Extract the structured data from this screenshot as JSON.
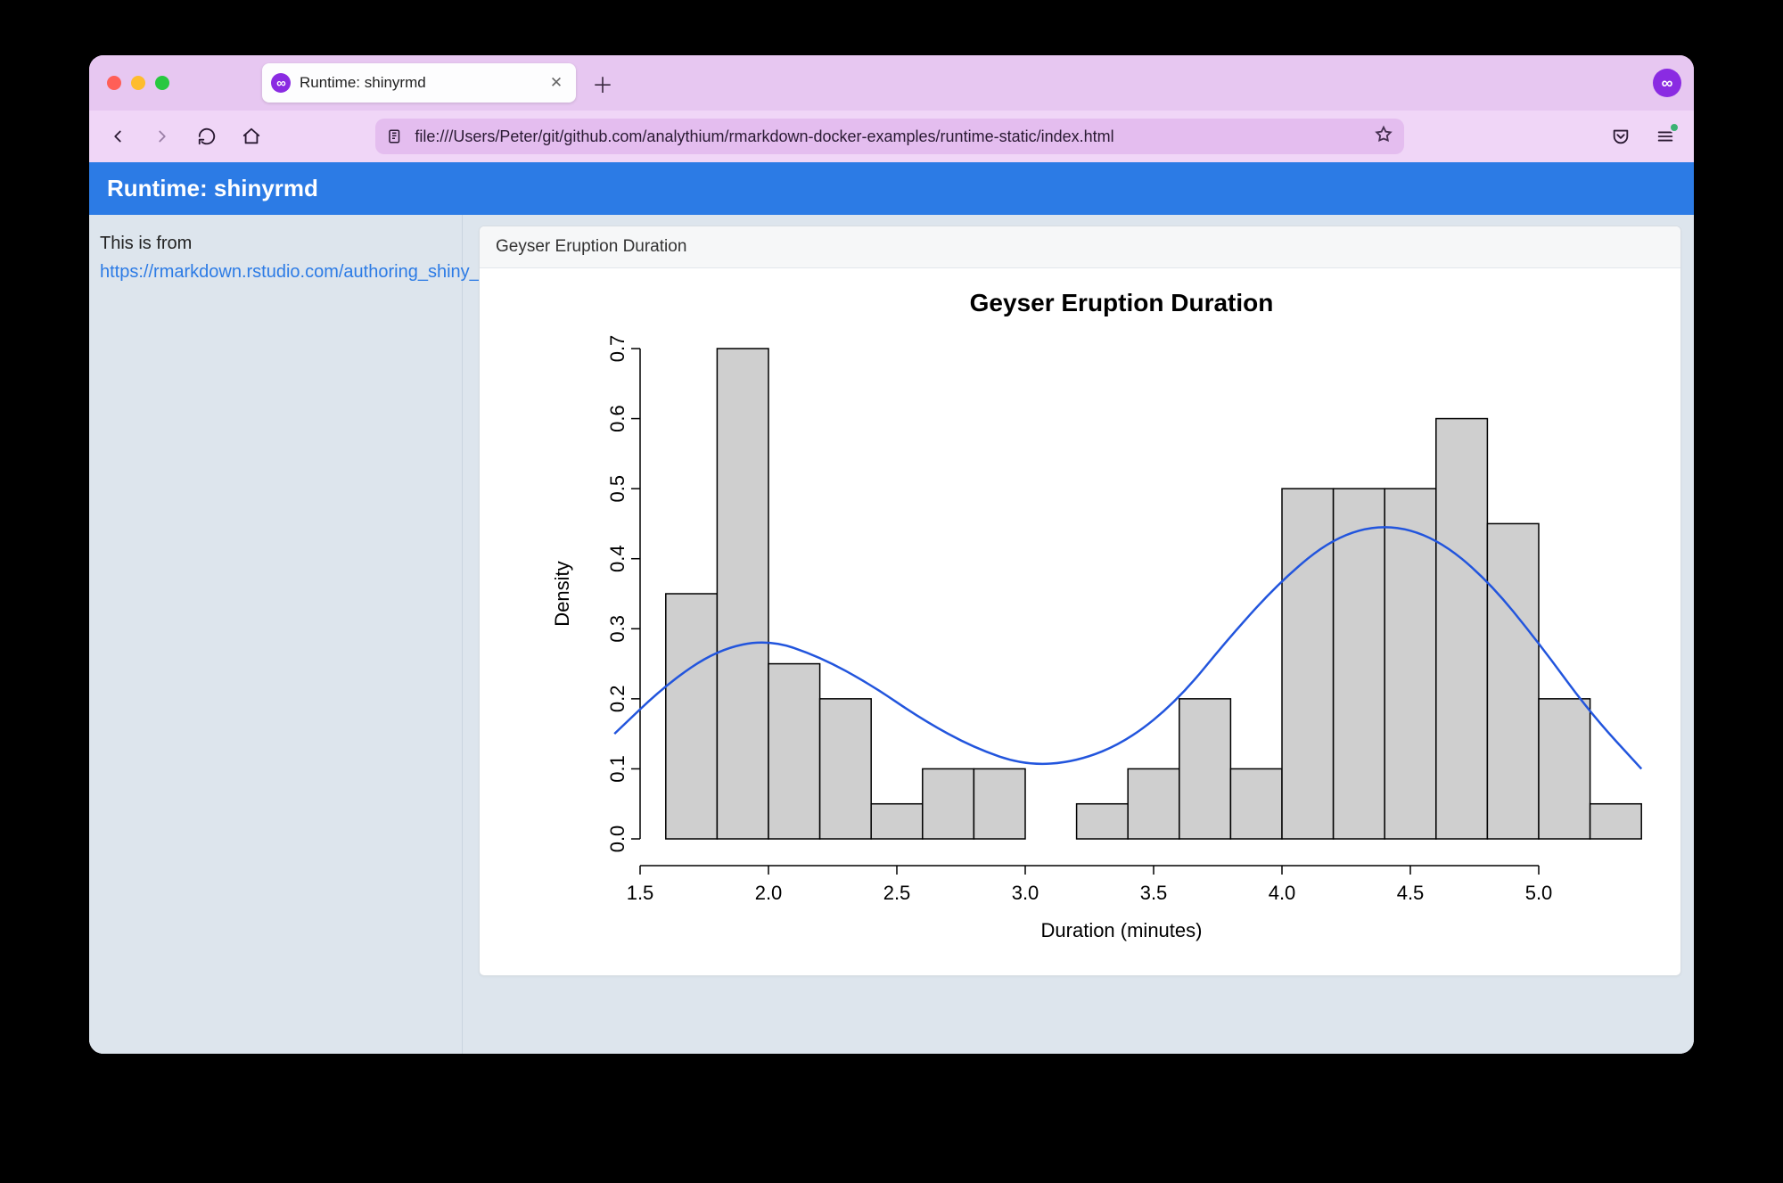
{
  "browser": {
    "tab_title": "Runtime: shinyrmd",
    "url": "file:///Users/Peter/git/github.com/analythium/rmarkdown-docker-examples/runtime-static/index.html"
  },
  "page": {
    "header_title": "Runtime: shinyrmd",
    "sidebar": {
      "intro_text": "This is from ",
      "link_text": "https://rmarkdown.rstudio.com/authoring_shiny_prerendered.HTML",
      "after_text": "."
    },
    "panel_heading": "Geyser Eruption Duration"
  },
  "chart_data": {
    "type": "bar",
    "title": "Geyser Eruption Duration",
    "xlabel": "Duration (minutes)",
    "ylabel": "Density",
    "xlim": [
      1.5,
      5.25
    ],
    "ylim": [
      0,
      0.7
    ],
    "x_ticks": [
      1.5,
      2.0,
      2.5,
      3.0,
      3.5,
      4.0,
      4.5,
      5.0
    ],
    "y_ticks": [
      0.0,
      0.1,
      0.2,
      0.3,
      0.4,
      0.5,
      0.6,
      0.7
    ],
    "bin_width": 0.2,
    "bars": [
      {
        "x0": 1.6,
        "x1": 1.8,
        "density": 0.35
      },
      {
        "x0": 1.8,
        "x1": 2.0,
        "density": 0.7
      },
      {
        "x0": 2.0,
        "x1": 2.2,
        "density": 0.25
      },
      {
        "x0": 2.2,
        "x1": 2.4,
        "density": 0.2
      },
      {
        "x0": 2.4,
        "x1": 2.6,
        "density": 0.05
      },
      {
        "x0": 2.6,
        "x1": 2.8,
        "density": 0.1
      },
      {
        "x0": 2.8,
        "x1": 3.0,
        "density": 0.1
      },
      {
        "x0": 3.0,
        "x1": 3.2,
        "density": 0.0
      },
      {
        "x0": 3.2,
        "x1": 3.4,
        "density": 0.05
      },
      {
        "x0": 3.4,
        "x1": 3.6,
        "density": 0.1
      },
      {
        "x0": 3.6,
        "x1": 3.8,
        "density": 0.2
      },
      {
        "x0": 3.8,
        "x1": 4.0,
        "density": 0.1
      },
      {
        "x0": 4.0,
        "x1": 4.2,
        "density": 0.5
      },
      {
        "x0": 4.2,
        "x1": 4.4,
        "density": 0.5
      },
      {
        "x0": 4.4,
        "x1": 4.6,
        "density": 0.5
      },
      {
        "x0": 4.6,
        "x1": 4.8,
        "density": 0.6
      },
      {
        "x0": 4.8,
        "x1": 5.0,
        "density": 0.45
      },
      {
        "x0": 5.0,
        "x1": 5.2,
        "density": 0.2
      },
      {
        "x0": 5.2,
        "x1": 5.4,
        "density": 0.05
      }
    ],
    "density_curve": [
      {
        "x": 1.4,
        "y": 0.15
      },
      {
        "x": 1.6,
        "y": 0.22
      },
      {
        "x": 1.8,
        "y": 0.27
      },
      {
        "x": 2.0,
        "y": 0.285
      },
      {
        "x": 2.2,
        "y": 0.26
      },
      {
        "x": 2.4,
        "y": 0.22
      },
      {
        "x": 2.6,
        "y": 0.17
      },
      {
        "x": 2.8,
        "y": 0.13
      },
      {
        "x": 3.0,
        "y": 0.105
      },
      {
        "x": 3.2,
        "y": 0.11
      },
      {
        "x": 3.4,
        "y": 0.14
      },
      {
        "x": 3.6,
        "y": 0.2
      },
      {
        "x": 3.8,
        "y": 0.29
      },
      {
        "x": 4.0,
        "y": 0.37
      },
      {
        "x": 4.2,
        "y": 0.43
      },
      {
        "x": 4.4,
        "y": 0.45
      },
      {
        "x": 4.6,
        "y": 0.43
      },
      {
        "x": 4.8,
        "y": 0.37
      },
      {
        "x": 5.0,
        "y": 0.28
      },
      {
        "x": 5.2,
        "y": 0.18
      },
      {
        "x": 5.4,
        "y": 0.1
      }
    ],
    "curve_color": "#2255dd",
    "bar_fill": "#cfcfcf",
    "bar_stroke": "#000000"
  }
}
